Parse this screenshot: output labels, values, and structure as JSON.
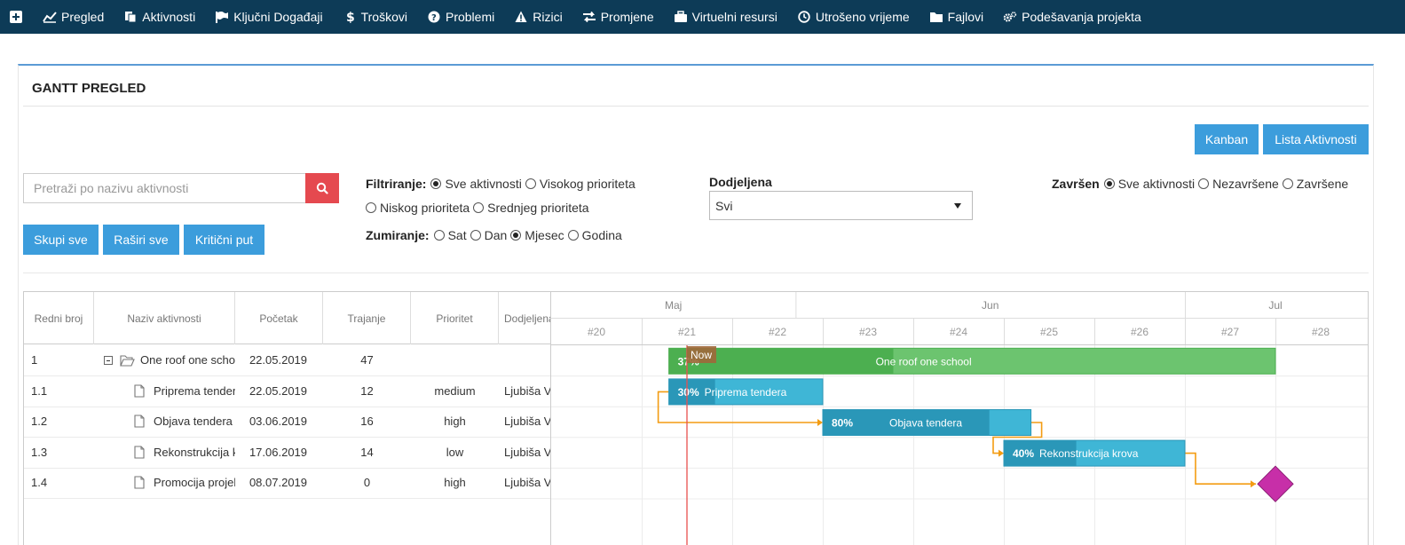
{
  "nav": {
    "items": [
      {
        "label": "Pregled",
        "icon": "chart-line-icon"
      },
      {
        "label": "Aktivnosti",
        "icon": "copy-icon"
      },
      {
        "label": "Ključni Događaji",
        "icon": "flag-icon"
      },
      {
        "label": "Troškovi",
        "icon": "dollar-icon"
      },
      {
        "label": "Problemi",
        "icon": "question-circle-icon"
      },
      {
        "label": "Rizici",
        "icon": "warning-icon"
      },
      {
        "label": "Promjene",
        "icon": "exchange-icon"
      },
      {
        "label": "Virtuelni resursi",
        "icon": "briefcase-icon"
      },
      {
        "label": "Utrošeno vrijeme",
        "icon": "clock-icon"
      },
      {
        "label": "Fajlovi",
        "icon": "folder-icon"
      },
      {
        "label": "Podešavanja projekta",
        "icon": "cogs-icon"
      }
    ]
  },
  "panel": {
    "title": "GANTT PREGLED"
  },
  "buttons": {
    "kanban": "Kanban",
    "lista": "Lista Aktivnosti",
    "skupi": "Skupi sve",
    "rasiri": "Raširi sve",
    "kriticni": "Kritični put"
  },
  "search": {
    "placeholder": "Pretraži po nazivu aktivnosti"
  },
  "filter": {
    "label": "Filtriranje:",
    "options": [
      "Sve aktivnosti",
      "Visokog prioriteta",
      "Niskog prioriteta",
      "Srednjeg prioriteta"
    ],
    "selected": 0
  },
  "zoom": {
    "label": "Zumiranje:",
    "options": [
      "Sat",
      "Dan",
      "Mjesec",
      "Godina"
    ],
    "selected": 2
  },
  "assigned": {
    "label": "Dodjeljena",
    "value": "Svi"
  },
  "done": {
    "label": "Završen",
    "options": [
      "Sve aktivnosti",
      "Nezavršene",
      "Završene"
    ],
    "selected": 0
  },
  "grid": {
    "columns": [
      "Redni broj",
      "Naziv aktivnosti",
      "Početak",
      "Trajanje",
      "Prioritet",
      "Dodjeljena"
    ],
    "rows": [
      {
        "no": "1",
        "name": "One roof one school",
        "start": "22.05.2019",
        "duration": "47",
        "priority": "",
        "assignee": "",
        "type": "folder"
      },
      {
        "no": "1.1",
        "name": "Priprema tendera",
        "start": "22.05.2019",
        "duration": "12",
        "priority": "medium",
        "assignee": "Ljubiša V",
        "type": "file"
      },
      {
        "no": "1.2",
        "name": "Objava tendera",
        "start": "03.06.2019",
        "duration": "16",
        "priority": "high",
        "assignee": "Ljubiša V",
        "type": "file"
      },
      {
        "no": "1.3",
        "name": "Rekonstrukcija krova",
        "start": "17.06.2019",
        "duration": "14",
        "priority": "low",
        "assignee": "Ljubiša V",
        "type": "file"
      },
      {
        "no": "1.4",
        "name": "Promocija projekta",
        "start": "08.07.2019",
        "duration": "0",
        "priority": "high",
        "assignee": "Ljubiša V",
        "type": "file"
      }
    ]
  },
  "chart_data": {
    "type": "gantt",
    "months": [
      {
        "label": "Maj",
        "startWeek": 20
      },
      {
        "label": "Jun",
        "startWeek": 22.7
      },
      {
        "label": "Jul",
        "startWeek": 27
      }
    ],
    "weeks": [
      "#20",
      "#21",
      "#22",
      "#23",
      "#24",
      "#25",
      "#26",
      "#27",
      "#28"
    ],
    "now_label": "Now",
    "now_week": 21.5,
    "tasks": [
      {
        "label": "One roof one school",
        "startWeek": 21.3,
        "endWeek": 28,
        "progress": 0.37,
        "progress_text": "37%",
        "color": "#4caf50",
        "fill": "#6cc46f",
        "kind": "summary"
      },
      {
        "label": "Priprema tendera",
        "startWeek": 21.3,
        "endWeek": 23,
        "progress": 0.3,
        "progress_text": "30%",
        "color": "#2a97b8",
        "fill": "#3fb6d6",
        "kind": "task"
      },
      {
        "label": "Objava tendera",
        "startWeek": 23,
        "endWeek": 25.3,
        "progress": 0.8,
        "progress_text": "80%",
        "color": "#2a97b8",
        "fill": "#3fb6d6",
        "kind": "task"
      },
      {
        "label": "Rekonstrukcija krova",
        "startWeek": 25,
        "endWeek": 27,
        "progress": 0.4,
        "progress_text": "40%",
        "color": "#2a97b8",
        "fill": "#3fb6d6",
        "kind": "task"
      },
      {
        "label": "",
        "startWeek": 28,
        "endWeek": 28,
        "progress": 0,
        "progress_text": "",
        "color": "#c72fa8",
        "fill": "#c72fa8",
        "kind": "milestone"
      }
    ],
    "links": [
      [
        1,
        2
      ],
      [
        2,
        3
      ],
      [
        3,
        4
      ]
    ]
  }
}
